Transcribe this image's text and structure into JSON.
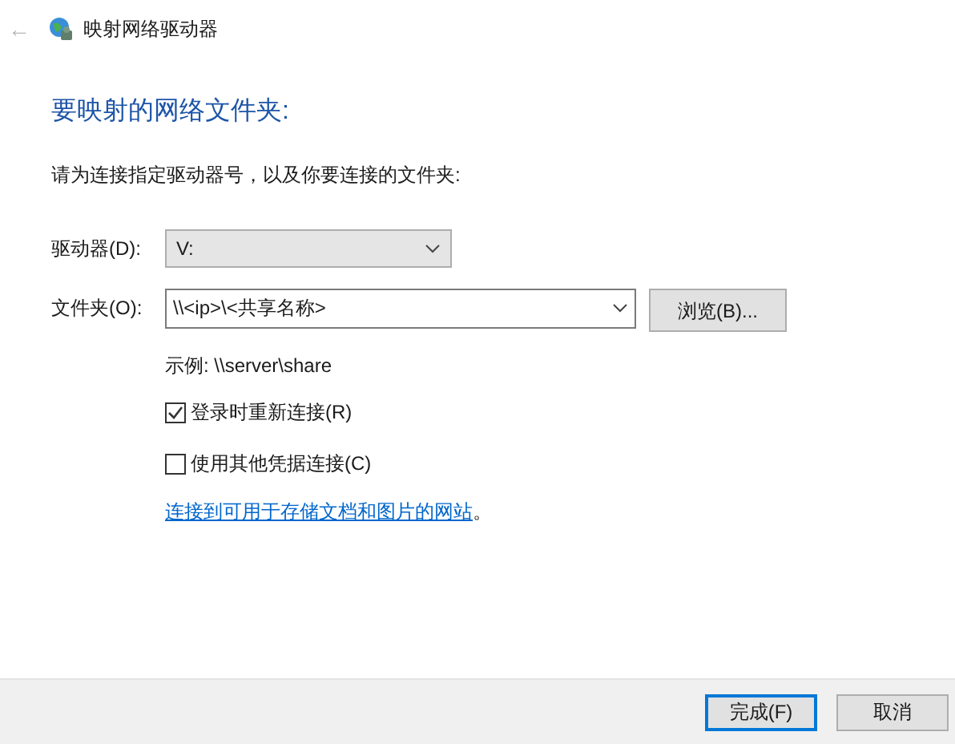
{
  "window": {
    "title": "映射网络驱动器",
    "back_arrow": "←"
  },
  "heading": "要映射的网络文件夹:",
  "instruction": "请为连接指定驱动器号，以及你要连接的文件夹:",
  "drive": {
    "label": "驱动器(D):",
    "value": "V:"
  },
  "folder": {
    "label": "文件夹(O):",
    "value": "\\\\<ip>\\<共享名称>",
    "browse_button": "浏览(B)..."
  },
  "example": "示例: \\\\server\\share",
  "options": [
    {
      "label": "登录时重新连接(R)",
      "checked": true
    },
    {
      "label": "使用其他凭据连接(C)",
      "checked": false
    }
  ],
  "link": {
    "text": "连接到可用于存储文档和图片的网站",
    "suffix": "。"
  },
  "buttons": [
    {
      "label": "完成(F)",
      "default": true
    },
    {
      "label": "取消",
      "default": false
    }
  ]
}
